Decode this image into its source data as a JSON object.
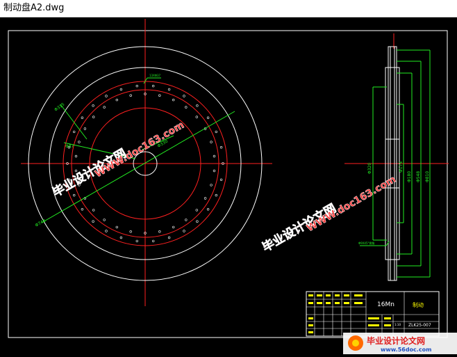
{
  "window": {
    "title": "制动盘A2.dwg"
  },
  "colors": {
    "red": "#ff2020",
    "white": "#ffffff",
    "green": "#22ee22",
    "yellow": "#ffff00",
    "watermark": "#ff3b3b"
  },
  "front_view": {
    "dims": {
      "d315": "Φ315",
      "d87": "Φ87",
      "d330": "Φ330",
      "d748": "Φ748",
      "hole_note": "13XΦ37"
    }
  },
  "side_view": {
    "dims": {
      "d320": "Φ320",
      "d174": "Φ174",
      "d180": "Φ180",
      "d548": "Φ548",
      "d810": "Φ810"
    },
    "note": "Φ9X45°倒角"
  },
  "title_block": {
    "material": "16Mn",
    "part_name": "制动",
    "drawing_no": "ZLK25-007",
    "scale": "1:10"
  },
  "watermarks": {
    "main": "毕业设计论文网",
    "url": "WWW.doc163.com"
  },
  "footer_logo": {
    "text": "毕业设计论文网",
    "url": "www.56doc.com"
  }
}
